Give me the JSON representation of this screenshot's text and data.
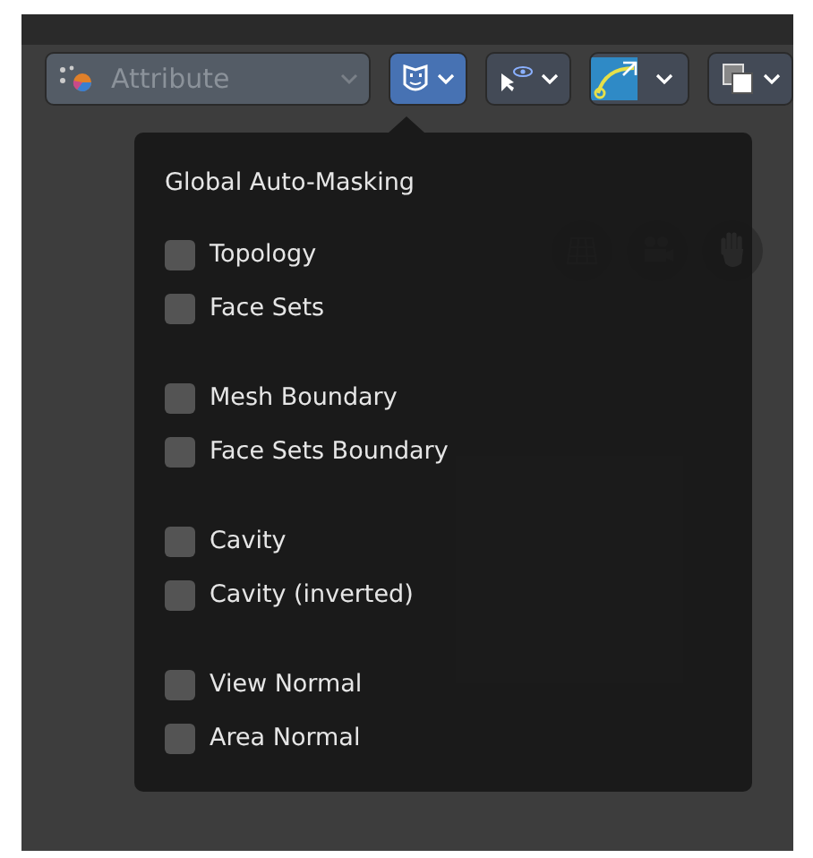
{
  "toolbar": {
    "attribute_dropdown": {
      "label": "Attribute"
    },
    "buttons": [
      {
        "kind": "mask",
        "selected": true
      },
      {
        "kind": "select",
        "selected": false
      },
      {
        "kind": "curve",
        "selected": false
      },
      {
        "kind": "overlay",
        "selected": false
      }
    ]
  },
  "popover": {
    "title": "Global Auto-Masking",
    "groups": [
      {
        "items": [
          {
            "label": "Topology",
            "checked": false
          },
          {
            "label": "Face Sets",
            "checked": false
          }
        ]
      },
      {
        "items": [
          {
            "label": "Mesh Boundary",
            "checked": false
          },
          {
            "label": "Face Sets Boundary",
            "checked": false
          }
        ]
      },
      {
        "items": [
          {
            "label": "Cavity",
            "checked": false
          },
          {
            "label": "Cavity (inverted)",
            "checked": false
          }
        ]
      },
      {
        "items": [
          {
            "label": "View Normal",
            "checked": false
          },
          {
            "label": "Area Normal",
            "checked": false
          }
        ]
      }
    ]
  }
}
